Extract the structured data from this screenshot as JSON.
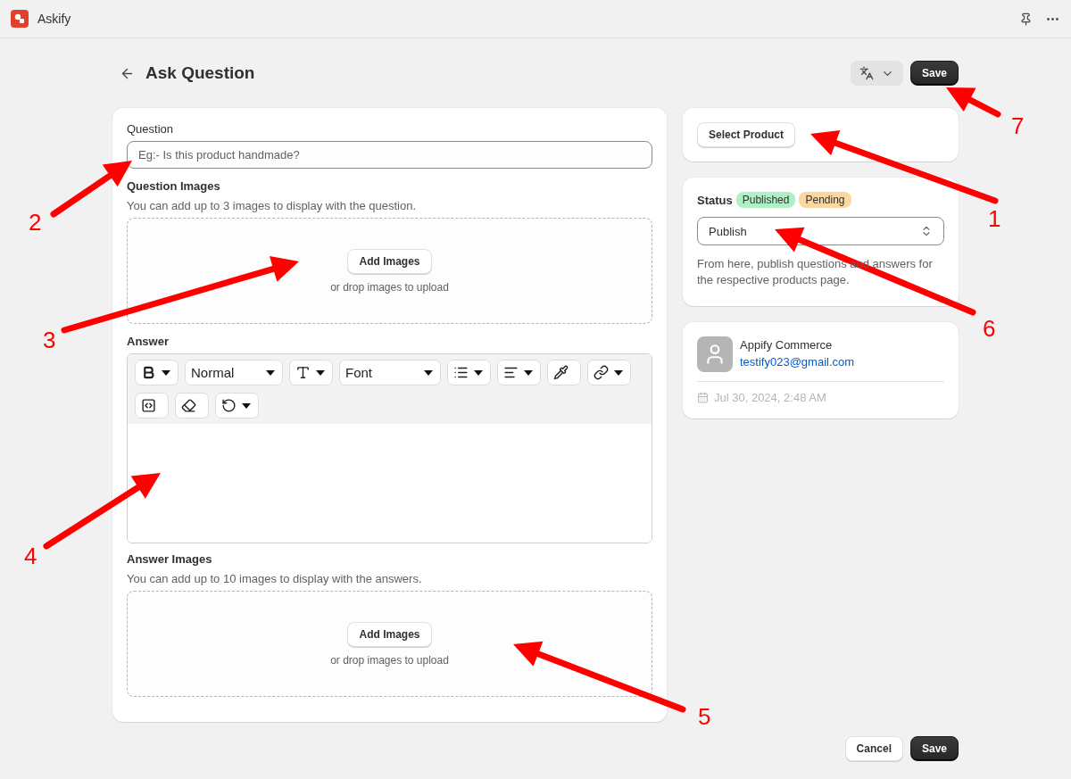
{
  "window": {
    "title": "Askify"
  },
  "page": {
    "title": "Ask Question",
    "save_label": "Save"
  },
  "question": {
    "label": "Question",
    "placeholder": "Eg:- Is this product handmade?"
  },
  "question_images": {
    "label": "Question Images",
    "help": "You can add up to 3 images to display with the question.",
    "button": "Add Images",
    "hint": "or drop images to upload"
  },
  "answer": {
    "label": "Answer",
    "toolbar": [
      {
        "kind": "icon",
        "caret": true
      },
      {
        "kind": "select",
        "label": "Normal",
        "caret": true
      },
      {
        "kind": "icon",
        "caret": true
      },
      {
        "kind": "select",
        "label": "Font",
        "caret": true
      },
      {
        "kind": "icon",
        "caret": true
      },
      {
        "kind": "icon",
        "caret": true
      },
      {
        "kind": "icon",
        "caret": false
      },
      {
        "kind": "icon",
        "caret": true
      },
      {
        "kind": "icon",
        "caret": false
      },
      {
        "kind": "icon",
        "caret": false
      },
      {
        "kind": "icon",
        "caret": true
      }
    ]
  },
  "answer_images": {
    "label": "Answer Images",
    "help": "You can add up to 10 images to display with the answers.",
    "button": "Add Images",
    "hint": "or drop images to upload"
  },
  "product": {
    "button": "Select Product"
  },
  "status": {
    "label": "Status",
    "badges": [
      {
        "label": "Published",
        "color": "#aff0c6"
      },
      {
        "label": "Pending",
        "color": "#fbd8a0"
      }
    ],
    "value": "Publish",
    "help": "From here, publish questions and answers for the respective products page."
  },
  "customer": {
    "name": "Appify Commerce",
    "email": "testify023@gmail.com",
    "date": "Jul 30, 2024, 2:48 AM"
  },
  "footer": {
    "cancel": "Cancel",
    "save": "Save"
  },
  "annotations": [
    {
      "label": "1"
    },
    {
      "label": "2"
    },
    {
      "label": "3"
    },
    {
      "label": "4"
    },
    {
      "label": "5"
    },
    {
      "label": "6"
    },
    {
      "label": "7"
    }
  ]
}
